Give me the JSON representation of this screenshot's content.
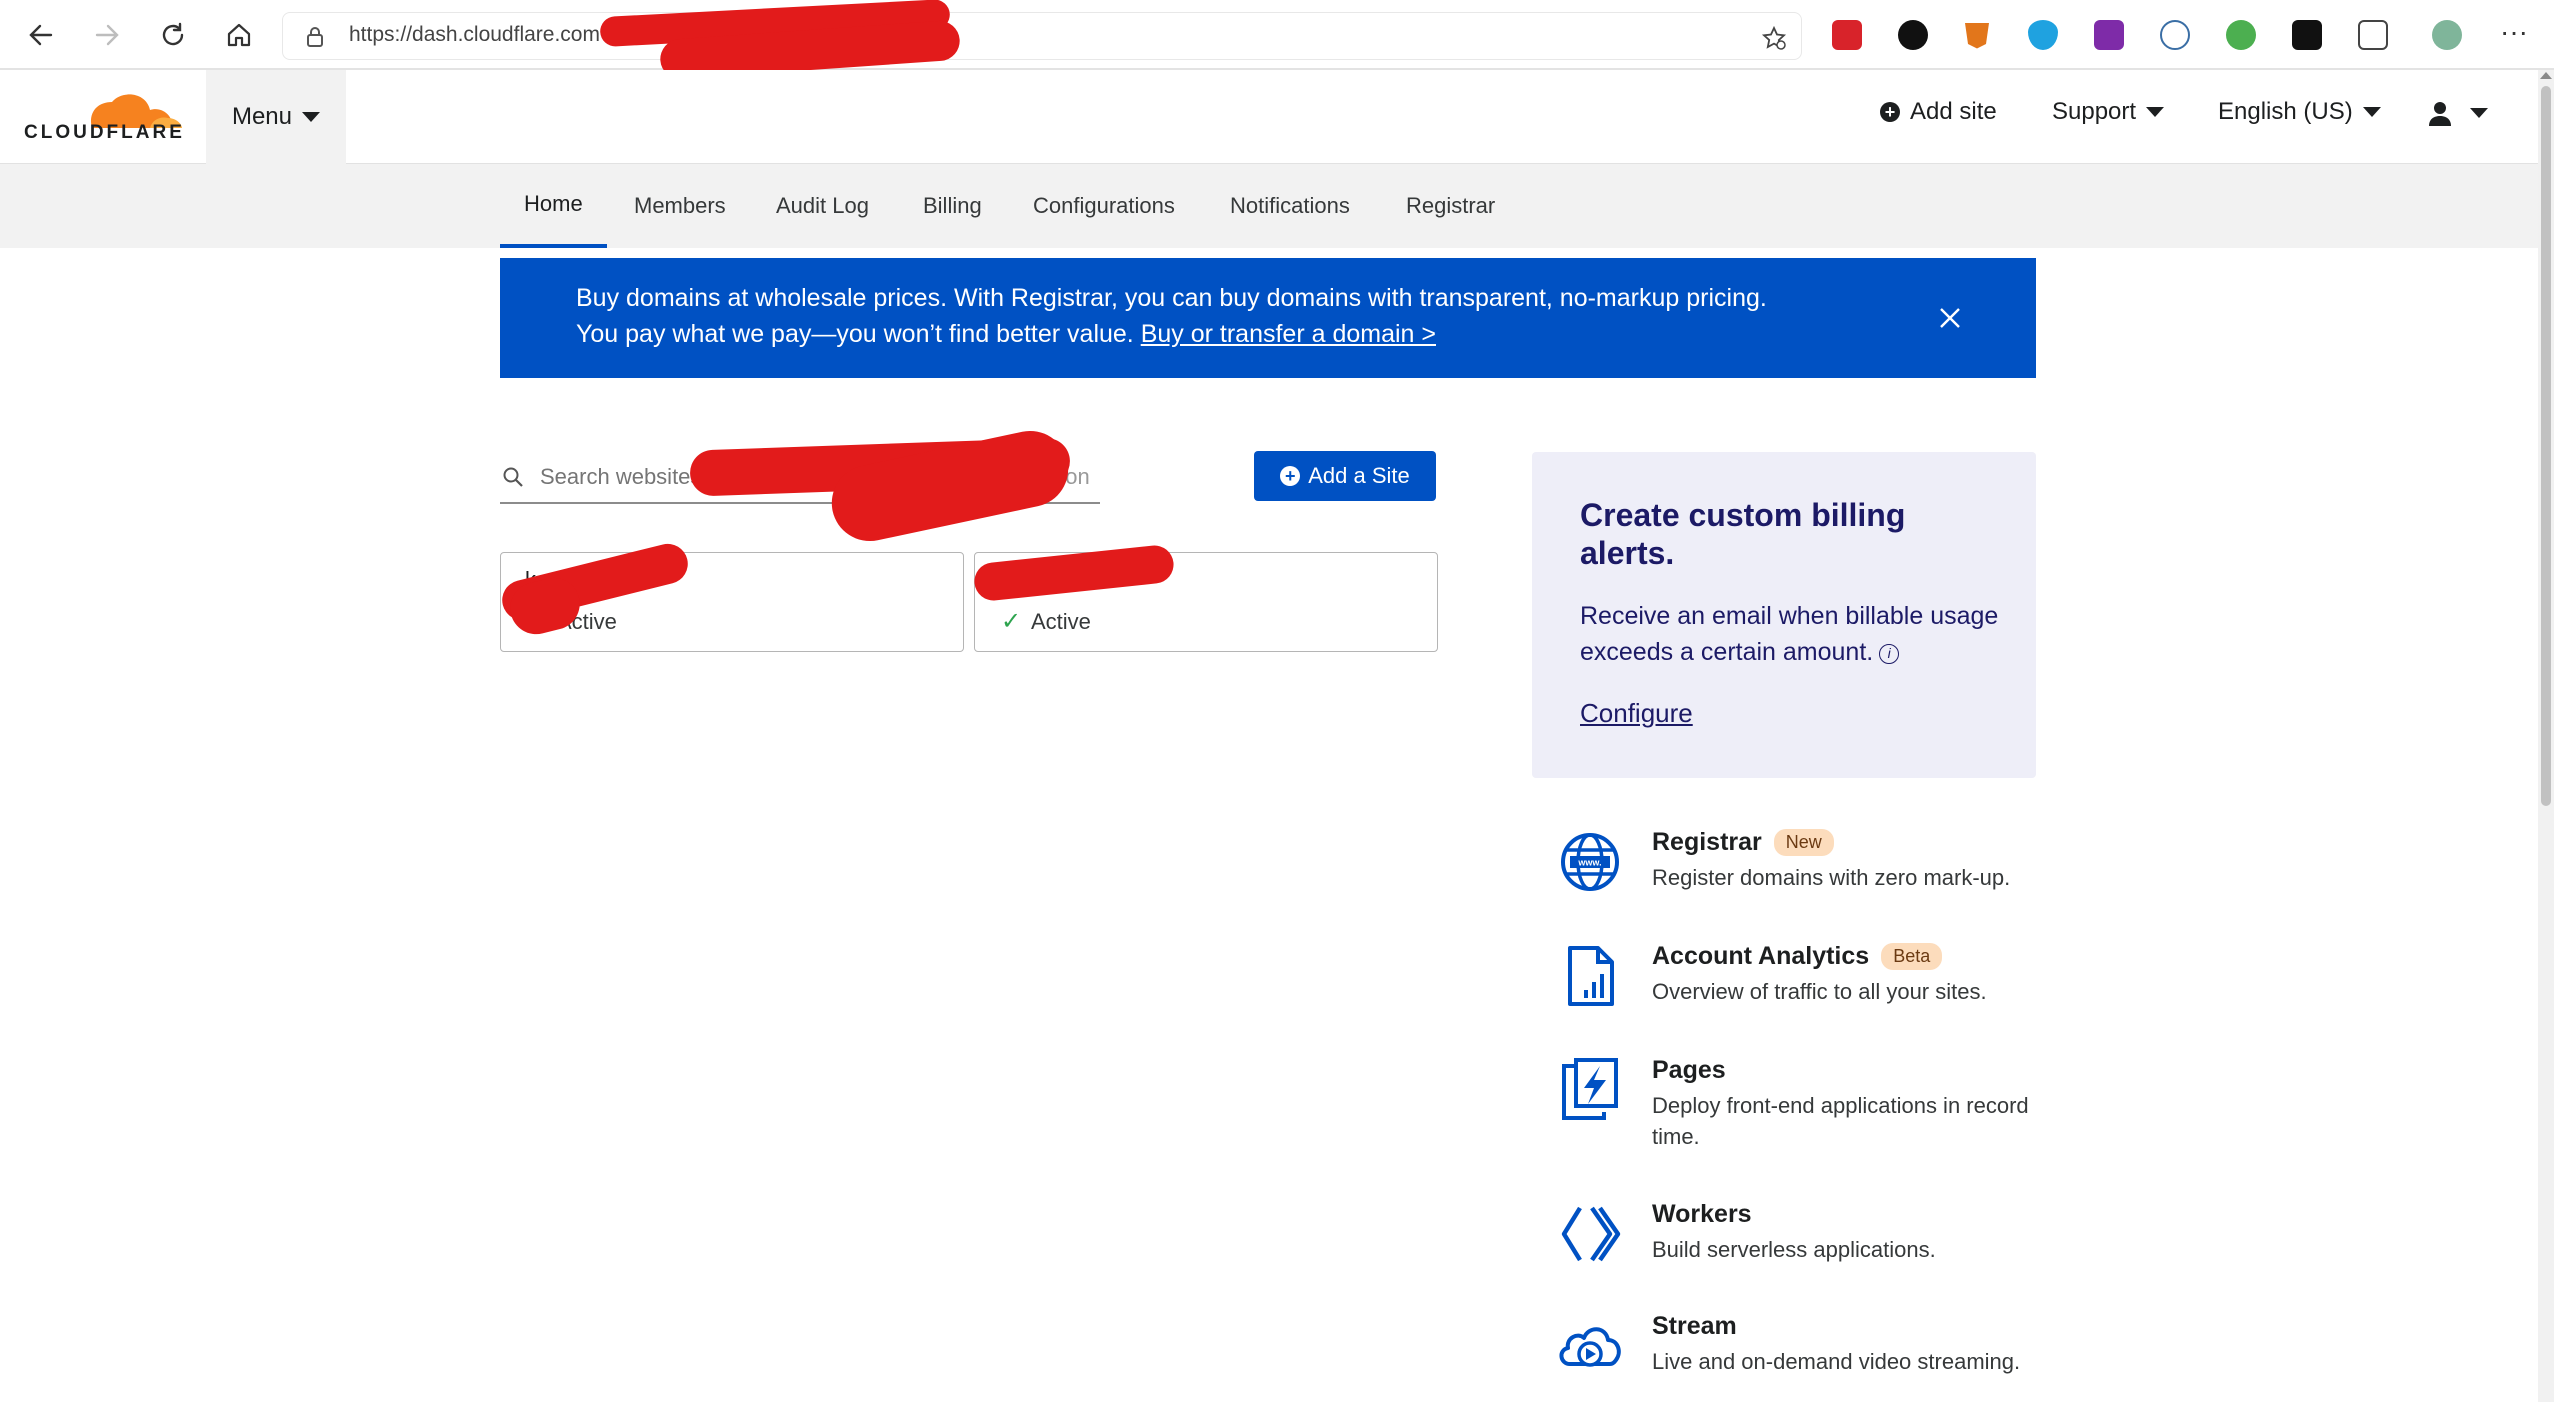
{
  "browser": {
    "url": "https://dash.cloudflare.com",
    "more_label": "···"
  },
  "header": {
    "brand": "CLOUDFLARE",
    "menu_label": "Menu",
    "add_site_label": "Add site",
    "support_label": "Support",
    "language_label": "English (US)"
  },
  "tabs": [
    {
      "label": "Home",
      "active": true
    },
    {
      "label": "Members"
    },
    {
      "label": "Audit Log"
    },
    {
      "label": "Billing"
    },
    {
      "label": "Configurations"
    },
    {
      "label": "Notifications"
    },
    {
      "label": "Registrar"
    }
  ],
  "banner": {
    "line1": "Buy domains at wholesale prices. With Registrar, you can buy domains with transparent, no-markup pricing.",
    "line2": "You pay what we pay—you won’t find better value. ",
    "link": "Buy or transfer a domain >"
  },
  "search": {
    "placeholder": "Search websites",
    "suffix": "t.con"
  },
  "add_site_button": "Add a Site",
  "sites": [
    {
      "name": "k",
      "status": "Active"
    },
    {
      "name": "",
      "status": "Active"
    }
  ],
  "billing_card": {
    "title": "Create custom billing alerts.",
    "description": "Receive an email when billable usage exceeds a certain amount.",
    "info_symbol": "i",
    "link": "Configure"
  },
  "products": [
    {
      "title": "Registrar",
      "badge": "New",
      "description": "Register domains with zero mark-up.",
      "icon": "globe-www-icon"
    },
    {
      "title": "Account Analytics",
      "badge": "Beta",
      "description": "Overview of traffic to all your sites.",
      "icon": "analytics-document-icon"
    },
    {
      "title": "Pages",
      "badge": "",
      "description": "Deploy front-end applications in record time.",
      "icon": "pages-lightning-icon"
    },
    {
      "title": "Workers",
      "badge": "",
      "description": "Build serverless applications.",
      "icon": "workers-brackets-icon"
    },
    {
      "title": "Stream",
      "badge": "",
      "description": "Live and on-demand video streaming.",
      "icon": "stream-cloud-play-icon"
    }
  ],
  "colors": {
    "accent": "#0051c3",
    "brand_orange": "#f6821f",
    "billing_bg": "#eeeef8",
    "billing_text": "#1c1a66",
    "badge_bg": "#fcdcbc"
  }
}
